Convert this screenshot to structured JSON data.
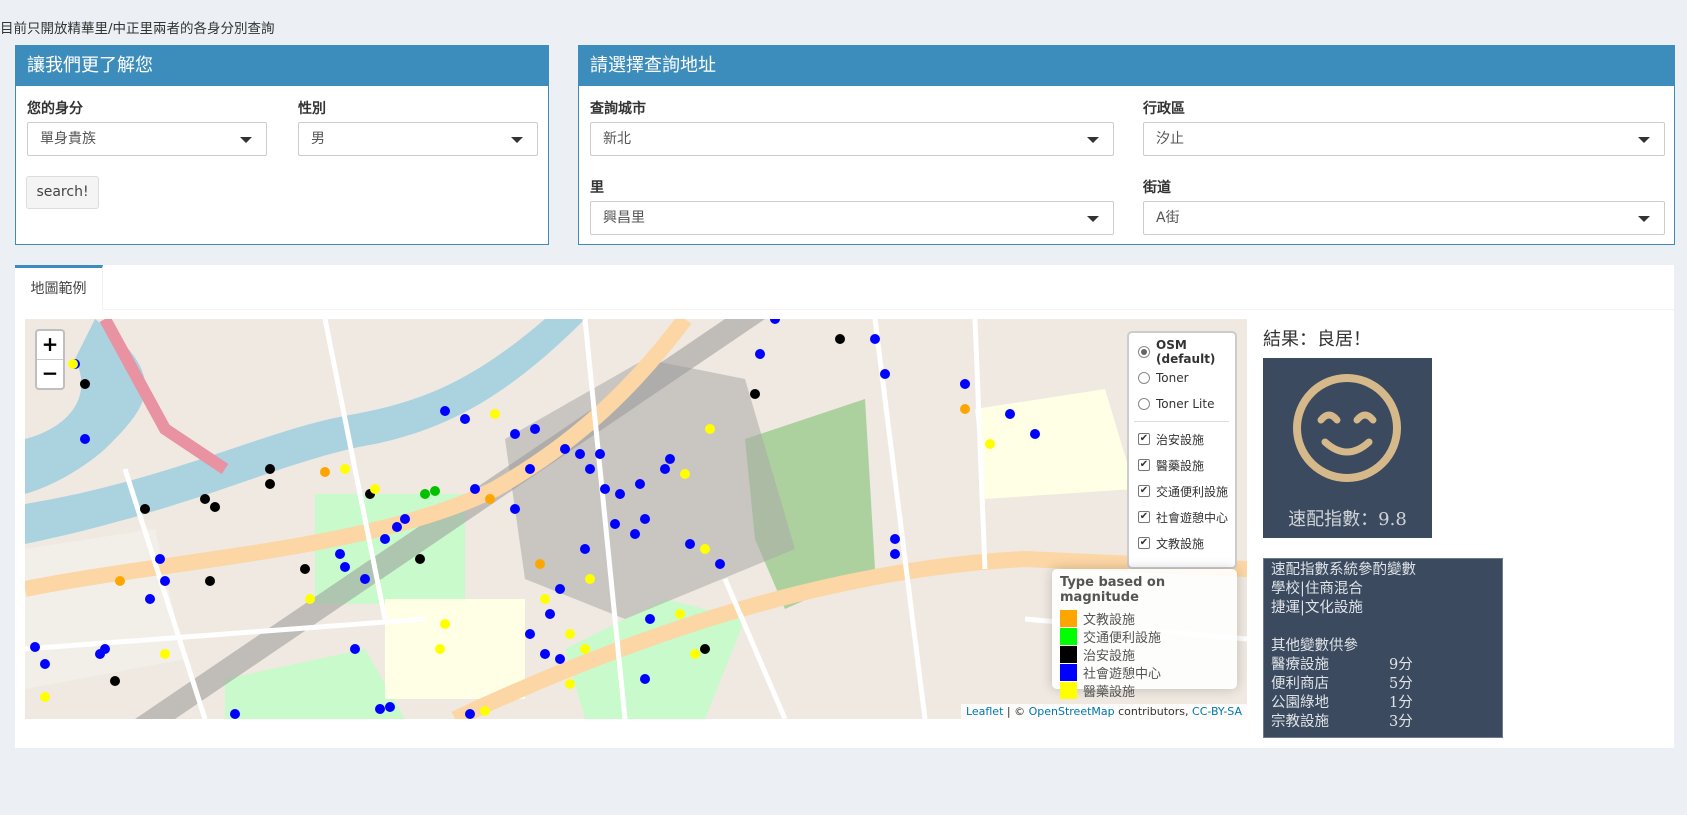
{
  "notice": "目前只開放精華里/中正里兩者的各身分別查詢",
  "profile": {
    "title": "讓我們更了解您",
    "identity_label": "您的身分",
    "identity_value": "單身貴族",
    "gender_label": "性別",
    "gender_value": "男",
    "search_label": "search!"
  },
  "address": {
    "title": "請選擇查詢地址",
    "city_label": "查詢城市",
    "city_value": "新北",
    "district_label": "行政區",
    "district_value": "汐止",
    "village_label": "里",
    "village_value": "興昌里",
    "street_label": "街道",
    "street_value": "A街"
  },
  "tabs": [
    {
      "label": "地圖範例"
    }
  ],
  "map": {
    "zoom_in": "+",
    "zoom_out": "−",
    "base_layers": [
      "OSM (default)",
      "Toner",
      "Toner Lite"
    ],
    "selected_base": "OSM (default)",
    "overlays": [
      "治安設施",
      "醫藥設施",
      "交通便利設施",
      "社會遊憩中心",
      "文教設施"
    ],
    "legend_title": "Type based on magnitude",
    "legend": [
      {
        "label": "文教設施",
        "color": "#ffa500"
      },
      {
        "label": "交通便利設施",
        "color": "#00ff00"
      },
      {
        "label": "治安設施",
        "color": "#000000"
      },
      {
        "label": "社會遊憩中心",
        "color": "#0000ff"
      },
      {
        "label": "醫藥設施",
        "color": "#ffff00"
      }
    ],
    "attribution": {
      "leaflet": "Leaflet",
      "sep": " | © ",
      "osm": "OpenStreetMap",
      "contrib": " contributors, ",
      "license": "CC-BY-SA"
    }
  },
  "result": {
    "title": "結果：良居！",
    "score": "速配指數：9.8",
    "vars_heading": "速配指數系統參酌變數",
    "vars": [
      "學校|住商混合",
      "捷運|文化設施"
    ],
    "other_heading": "其他變數供參",
    "others": [
      {
        "name": "醫療設施",
        "score": "9分"
      },
      {
        "name": "便利商店",
        "score": "5分"
      },
      {
        "name": "公園綠地",
        "score": "1分"
      },
      {
        "name": "宗教設施",
        "score": "3分"
      }
    ]
  }
}
